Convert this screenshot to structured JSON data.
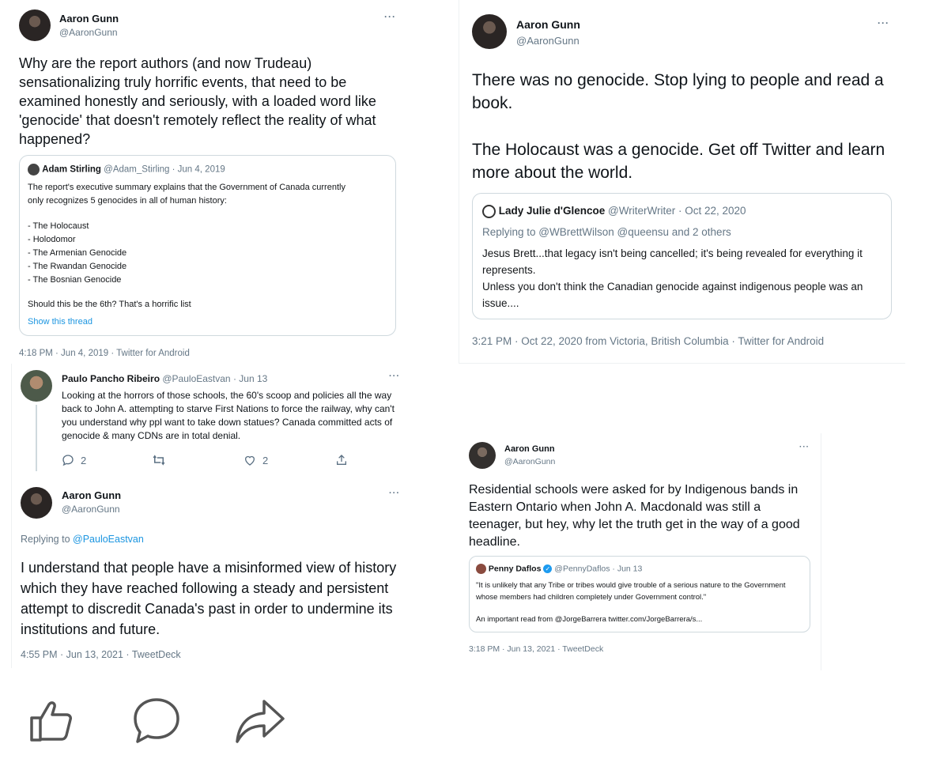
{
  "tweet1": {
    "name": "Aaron Gunn",
    "handle": "@AaronGunn",
    "more": "···",
    "text": "Why are the report authors (and now Trudeau) sensationalizing truly horrific events, that need to be examined honestly and seriously, with a loaded word like 'genocide' that doesn't remotely reflect the reality of what happened?",
    "quote": {
      "name": "Adam Stirling",
      "handle_date": "@Adam_Stirling · Jun 4, 2019",
      "line1": "The report's executive summary explains that the Government of Canada currently only recognizes 5 genocides in all of human history:",
      "list": [
        "- The Holocaust",
        "- Holodomor",
        "- The Armenian Genocide",
        "- The Rwandan Genocide",
        "- The Bosnian Genocide"
      ],
      "closing": "Should this be the 6th? That's a horrific list",
      "show_thread": "Show this thread"
    },
    "timestamp": "4:18 PM · Jun 4, 2019 · Twitter for Android"
  },
  "tweet2": {
    "name": "Aaron Gunn",
    "handle": "@AaronGunn",
    "more": "···",
    "text1": "There was no genocide. Stop lying to people and read a book.",
    "text2": "The Holocaust was a genocide. Get off Twitter and learn more about the world.",
    "quote": {
      "name": "Lady Julie d'Glencoe",
      "handle_date": "@WriterWriter · Oct 22, 2020",
      "replying": "Replying to @WBrettWilson @queensu and 2 others",
      "line1": "Jesus Brett...that legacy isn't being cancelled; it's being revealed for everything it represents.",
      "line2": "Unless you don't think the Canadian genocide against indigenous people was an issue...."
    },
    "timestamp": "3:21 PM · Oct 22, 2020 from Victoria, British Columbia · Twitter for Android"
  },
  "tweet3": {
    "reply": {
      "name": "Paulo Pancho Ribeiro",
      "handle_date": "@PauloEastvan · Jun 13",
      "more": "···",
      "text": "Looking at the horrors of those schools, the 60's scoop and policies all the way back to John A. attempting to starve First Nations to force the railway, why can't you understand why ppl want to take down statues? Canada committed acts of genocide & many CDNs are in total denial.",
      "reply_count": "2",
      "like_count": "2"
    },
    "name": "Aaron Gunn",
    "handle": "@AaronGunn",
    "more": "···",
    "replying_prefix": "Replying to ",
    "replying_to": "@PauloEastvan",
    "text": "I understand that people have a misinformed view of history which they have reached following a steady and persistent attempt to discredit Canada's past in order to undermine its institutions and future.",
    "timestamp": "4:55 PM · Jun 13, 2021 · TweetDeck"
  },
  "tweet4": {
    "name": "Aaron Gunn",
    "handle": "@AaronGunn",
    "more": "···",
    "text": "Residential schools were asked for by Indigenous bands in Eastern Ontario when John A. Macdonald was still a teenager, but hey, why let the truth get in the way of a good headline.",
    "quote": {
      "name": "Penny Daflos",
      "handle_date": "@PennyDaflos · Jun 13",
      "line1": "\"It is unlikely that any Tribe or tribes would give trouble of a serious nature to the Government whose members had children completely under Government control.\"",
      "line2": "An important read from @JorgeBarrera twitter.com/JorgeBarrera/s..."
    },
    "timestamp": "3:18 PM · Jun 13, 2021 · TweetDeck"
  },
  "icons": [
    "thumbs-up-icon",
    "comment-icon",
    "share-icon"
  ],
  "colors": {
    "link": "#1b95e0",
    "muted": "#657786",
    "border": "#cfd9de",
    "verified": "#1d9bf0"
  }
}
